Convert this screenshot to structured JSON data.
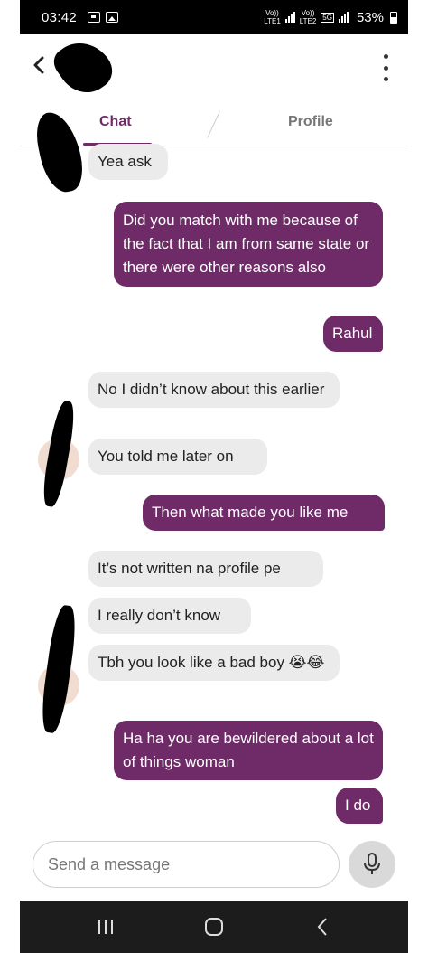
{
  "status_bar": {
    "time": "03:42",
    "network1_label": "Vo))",
    "network1_sub": "LTE1",
    "network2_label": "Vo))",
    "network2_sub": "LTE2",
    "net_badge": "5G",
    "battery": "53%"
  },
  "header": {
    "back_icon": "chevron-left-icon",
    "menu_icon": "vertical-dots-icon"
  },
  "tabs": [
    {
      "label": "Chat",
      "active": true
    },
    {
      "label": "Profile",
      "active": false
    }
  ],
  "messages": [
    {
      "from": "them",
      "text": "Yea ask"
    },
    {
      "from": "me",
      "text": "Did you match with me because of the fact that I am  from same state or there were other reasons also"
    },
    {
      "from": "me",
      "text": "Rahul"
    },
    {
      "from": "them",
      "text": "No I didn’t know about this earlier"
    },
    {
      "from": "them",
      "text": "You told me later on"
    },
    {
      "from": "me",
      "text": "Then what made you like me"
    },
    {
      "from": "them",
      "text": "It’s not written na profile pe"
    },
    {
      "from": "them",
      "text": "I really don’t know"
    },
    {
      "from": "them",
      "text": "Tbh you look like a bad boy 😭😂"
    },
    {
      "from": "me",
      "text": "Ha ha you are bewildered about a lot of things woman"
    },
    {
      "from": "me",
      "text": "I do"
    }
  ],
  "composer": {
    "placeholder": "Send a message",
    "mic_icon": "microphone-icon"
  },
  "colors": {
    "accent": "#6e2b67",
    "incoming_bubble": "#ebebeb",
    "nav_bar": "#1c1c1c"
  }
}
